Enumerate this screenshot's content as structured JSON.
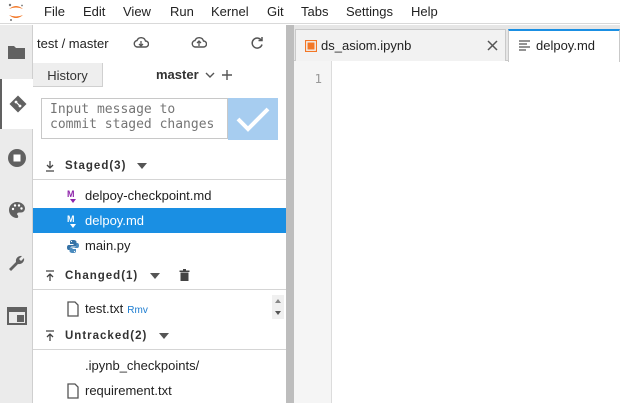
{
  "menubar": {
    "items": [
      "File",
      "Edit",
      "View",
      "Run",
      "Kernel",
      "Git",
      "Tabs",
      "Settings",
      "Help"
    ]
  },
  "git": {
    "repo_path": "test / master",
    "history_tab": "History",
    "branch": "master",
    "commit_placeholder": "Input message to commit staged changes",
    "sections": {
      "staged": "Staged(3)",
      "changed": "Changed(1)",
      "untracked": "Untracked(2)"
    },
    "staged_files": [
      "delpoy-checkpoint.md",
      "delpoy.md",
      "main.py"
    ],
    "changed_files": [
      {
        "name": "test.txt",
        "tag": "Rmv"
      }
    ],
    "untracked_files": [
      ".ipynb_checkpoints/",
      "requirement.txt"
    ]
  },
  "editor": {
    "tabs": [
      "ds_asiom.ipynb",
      "delpoy.md"
    ],
    "line_number": "1"
  },
  "colors": {
    "accent": "#1a8fe3",
    "commit_button": "#a7cdf0",
    "markdown_icon": "#8e24aa",
    "python_icon": "#3572a5",
    "notebook_icon": "#f37726"
  }
}
